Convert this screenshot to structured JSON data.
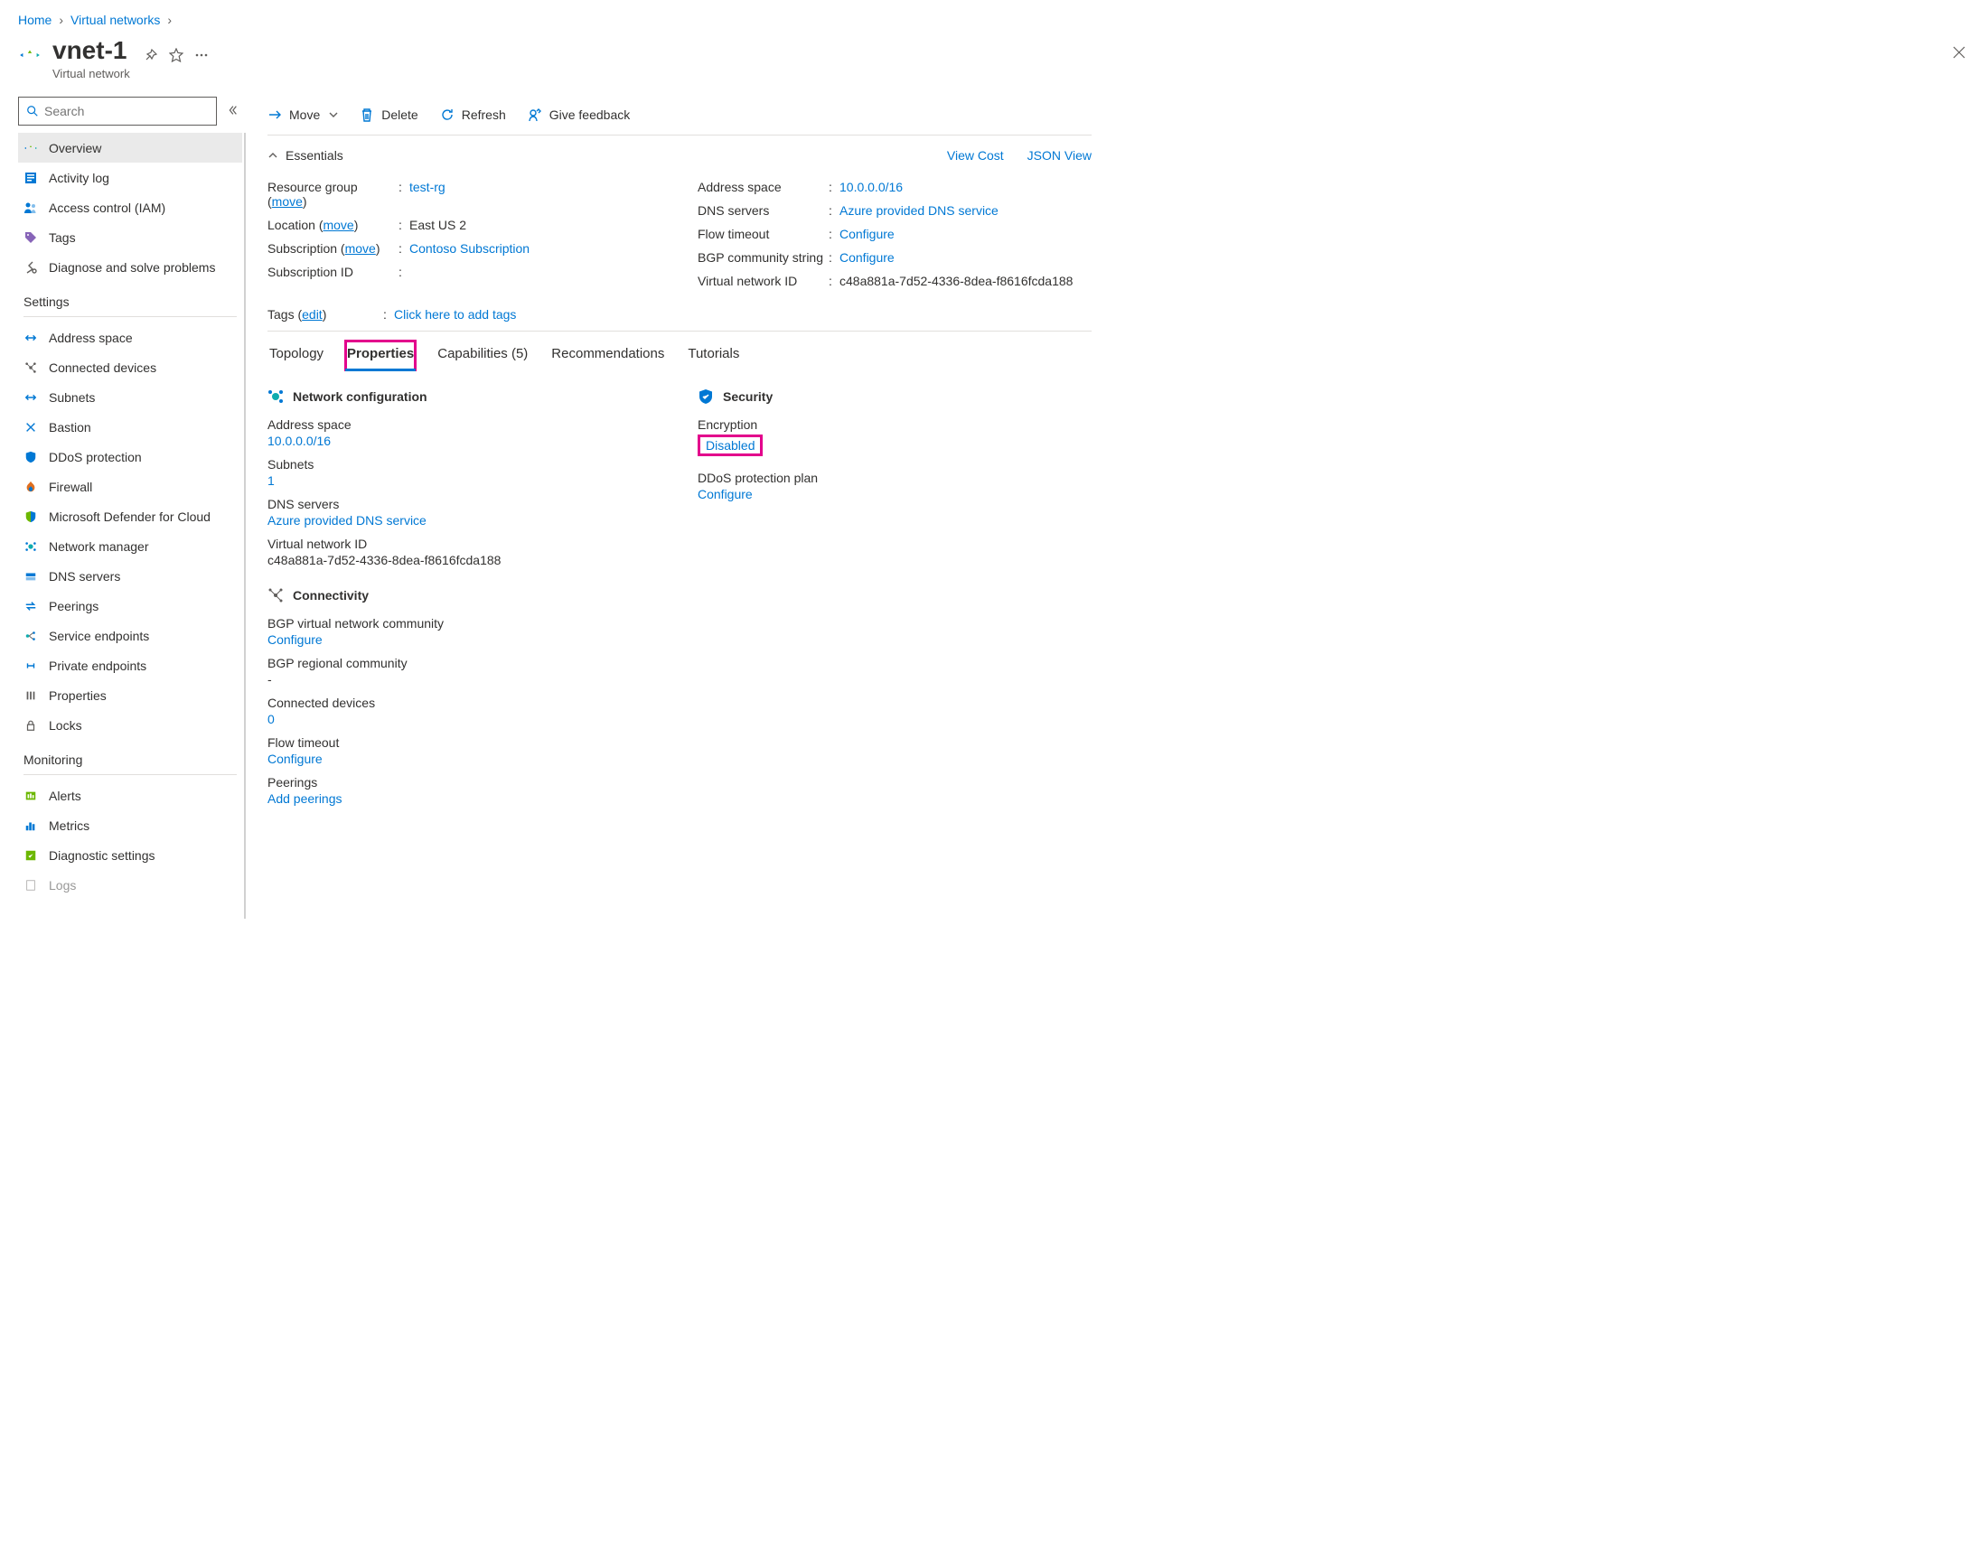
{
  "breadcrumb": {
    "home": "Home",
    "vnets": "Virtual networks"
  },
  "header": {
    "title": "vnet-1",
    "subtitle": "Virtual network"
  },
  "search": {
    "placeholder": "Search"
  },
  "sidebar": {
    "items": [
      {
        "label": "Overview"
      },
      {
        "label": "Activity log"
      },
      {
        "label": "Access control (IAM)"
      },
      {
        "label": "Tags"
      },
      {
        "label": "Diagnose and solve problems"
      }
    ],
    "settingsTitle": "Settings",
    "settings": [
      {
        "label": "Address space"
      },
      {
        "label": "Connected devices"
      },
      {
        "label": "Subnets"
      },
      {
        "label": "Bastion"
      },
      {
        "label": "DDoS protection"
      },
      {
        "label": "Firewall"
      },
      {
        "label": "Microsoft Defender for Cloud"
      },
      {
        "label": "Network manager"
      },
      {
        "label": "DNS servers"
      },
      {
        "label": "Peerings"
      },
      {
        "label": "Service endpoints"
      },
      {
        "label": "Private endpoints"
      },
      {
        "label": "Properties"
      },
      {
        "label": "Locks"
      }
    ],
    "monitoringTitle": "Monitoring",
    "monitoring": [
      {
        "label": "Alerts"
      },
      {
        "label": "Metrics"
      },
      {
        "label": "Diagnostic settings"
      },
      {
        "label": "Logs"
      }
    ]
  },
  "cmdbar": {
    "move": "Move",
    "delete": "Delete",
    "refresh": "Refresh",
    "feedback": "Give feedback"
  },
  "essentials": {
    "title": "Essentials",
    "viewCost": "View Cost",
    "jsonView": "JSON View",
    "left": {
      "rgLabel": "Resource group (",
      "rgMove": "move",
      "rgClose": ")",
      "rgVal": "test-rg",
      "locLabel": "Location (",
      "locMove": "move",
      "locClose": ")",
      "locVal": "East US 2",
      "subLabel": "Subscription (",
      "subMove": "move",
      "subClose": ")",
      "subVal": "Contoso Subscription",
      "subIdLabel": "Subscription ID",
      "subIdVal": ""
    },
    "right": {
      "addrLabel": "Address space",
      "addrVal": "10.0.0.0/16",
      "dnsLabel": "DNS servers",
      "dnsVal": "Azure provided DNS service",
      "flowLabel": "Flow timeout",
      "flowVal": "Configure",
      "bgpLabel": "BGP community string",
      "bgpVal": "Configure",
      "vnetIdLabel": "Virtual network ID",
      "vnetIdVal": "c48a881a-7d52-4336-8dea-f8616fcda188"
    },
    "tagsLabel": "Tags (",
    "tagsEdit": "edit",
    "tagsClose": ")",
    "tagsVal": "Click here to add tags"
  },
  "tabs": {
    "topology": "Topology",
    "properties": "Properties",
    "capabilities": "Capabilities (5)",
    "recommendations": "Recommendations",
    "tutorials": "Tutorials"
  },
  "props": {
    "netcfgTitle": "Network configuration",
    "secTitle": "Security",
    "addrLabel": "Address space",
    "addrVal": "10.0.0.0/16",
    "subnetsLabel": "Subnets",
    "subnetsVal": "1",
    "dnsLabel": "DNS servers",
    "dnsVal": "Azure provided DNS service",
    "vnetIdLabel": "Virtual network ID",
    "vnetIdVal": "c48a881a-7d52-4336-8dea-f8616fcda188",
    "connTitle": "Connectivity",
    "bgpVnetLabel": "BGP virtual network community",
    "bgpVnetVal": "Configure",
    "bgpRegLabel": "BGP regional community",
    "bgpRegVal": "-",
    "cdLabel": "Connected devices",
    "cdVal": "0",
    "flowLabel": "Flow timeout",
    "flowVal": "Configure",
    "peerLabel": "Peerings",
    "peerVal": "Add peerings",
    "encLabel": "Encryption",
    "encVal": "Disabled",
    "ddosLabel": "DDoS protection plan",
    "ddosVal": "Configure"
  }
}
